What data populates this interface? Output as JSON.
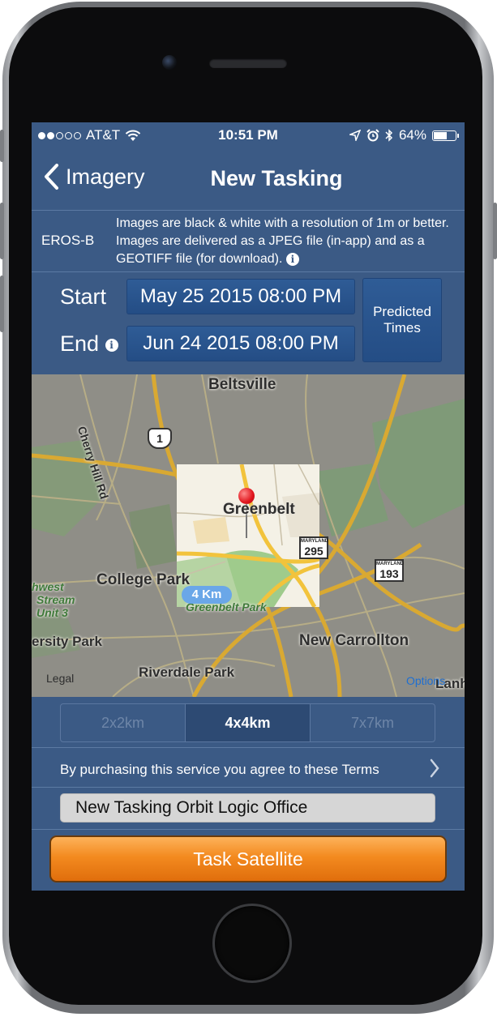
{
  "status_bar": {
    "carrier": "AT&T",
    "signal_bars_filled": 2,
    "signal_bars_total": 5,
    "time": "10:51 PM",
    "battery_percent": "64%",
    "battery_level": 0.64
  },
  "nav": {
    "back_label": "Imagery",
    "title": "New Tasking"
  },
  "satellite": {
    "name": "EROS-B",
    "description": "Images are black & white with a resolution of 1m or better.  Images are delivered as a JPEG file (in-app) and as a GEOTIFF file (for download)."
  },
  "dates": {
    "start_label": "Start",
    "start_value": "May 25 2015 08:00 PM",
    "end_label": "End",
    "end_value": "Jun 24 2015 08:00 PM",
    "predicted_line1": "Predicted",
    "predicted_line2": "Times"
  },
  "map": {
    "places": {
      "beltsville": "Beltsville",
      "cherry_hill": "Cherry Hill Rd",
      "greenbelt": "Greenbelt",
      "college_park": "College Park",
      "greenbelt_park": "Greenbelt Park",
      "new_carrollton": "New Carrollton",
      "riverdale_park": "Riverdale Park",
      "ersity_park": "ersity Park",
      "nwest_l1": "hwest",
      "nwest_l2": "Stream",
      "nwest_l3": "Unit 3",
      "lanh": "Lanh"
    },
    "shields": {
      "us1": "1",
      "md_label": "MARYLAND",
      "md295": "295",
      "md193": "193"
    },
    "scale_label": "4 Km",
    "legal": "Legal",
    "options": "Options"
  },
  "sizes": {
    "options": [
      "2x2km",
      "4x4km",
      "7x7km"
    ],
    "selected_index": 1
  },
  "terms": {
    "text": "By purchasing this service you agree to these Terms"
  },
  "tasking_name": {
    "value": "New Tasking Orbit Logic Office"
  },
  "task_button": {
    "label": "Task Satellite"
  },
  "colors": {
    "screen_bg": "#3b5a85",
    "button_blue": "#2a5590",
    "task_orange": "#f38a1f"
  }
}
